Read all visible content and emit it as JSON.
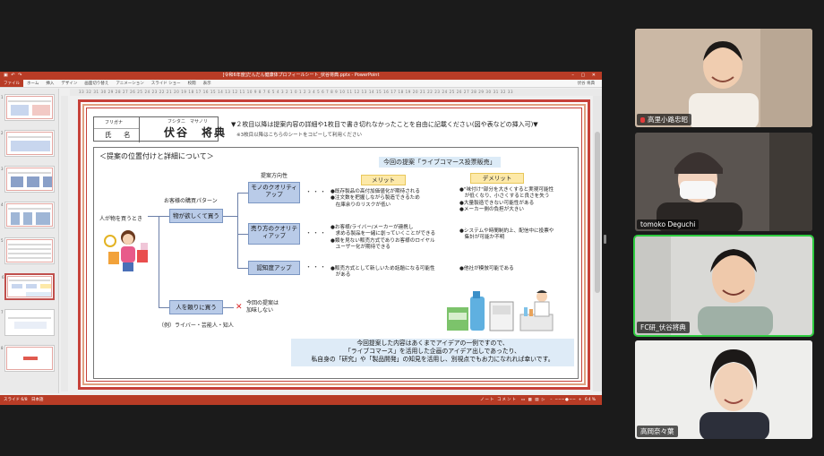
{
  "powerpoint": {
    "title": "[令和6年度]だんだん健康体プロフィールシート_伏谷将典.pptx - PowerPoint",
    "user": "伏谷 将典",
    "file_tab": "ファイル",
    "tabs": [
      "ホーム",
      "挿入",
      "デザイン",
      "画面切り替え",
      "アニメーション",
      "スライド ショー",
      "校閲",
      "表示"
    ],
    "ruler": "33 32 31 30 29 28 27 26 25 24 23 22 21 20 19 18 17 16 15 14 13 12 11 10 9 8 7 6 5 4 3 2 1 0 1 2 3 4 5 6 7 8 9 10 11 12 13 14 15 16 17 18 19 20 21 22 23 24 25 26 27 28 29 30 31 32 33",
    "status_left": "スライド 6/8",
    "status_lang": "日本語",
    "status_right": "ノート  コメント",
    "zoom": "64%",
    "thumbnails": [
      "1",
      "2",
      "3",
      "4",
      "5",
      "6",
      "7",
      "8"
    ]
  },
  "slide": {
    "furigana_label": "フリガナ",
    "name_label": "氏　名",
    "name_reading": "フシタニ　マサノリ",
    "name_value": "伏谷　将典",
    "instruction": "▼２枚目以降は提案内容の詳細や1枚目で書き切れなかったことを自由に記載ください(図や表などの挿入可)▼",
    "instruction_sub": "※3枚目以降はこちらのシートをコピーして利用ください",
    "section_title": "＜提案の位置付けと詳細について＞",
    "proposal_title": "今回の提案「ライブコマース投票販売」",
    "customer_label": "人が物を買うとき",
    "pattern_label": "お客様の購買パターン",
    "direction_label": "提案方向性",
    "box_want": "物が欲しくて買う",
    "box_relation": "人を頼りに買う",
    "box_quality": "モノのクオリティアップ",
    "box_seller": "売り方のクオリティアップ",
    "box_awareness": "認知度アップ",
    "merit": "メリット",
    "demerit": "デメリット",
    "merits_1": [
      "●既存製品の高付加価値化が期待される",
      "●注文数を把握しながら製造できるため",
      "　在庫余りのリスクが低い"
    ],
    "merits_2": [
      "●お客様/ライバー/メーカーが連携し",
      "　求める製品を一緒に創っていくことができる",
      "●類を見ない販売方式でありお客様のロイヤル",
      "　ユーザー化が期待できる"
    ],
    "merits_3": [
      "●販売方式として新しいため話題になる可能性",
      "　がある"
    ],
    "demerits_1": [
      "●\"味付け\"部分を大きくすると実現可能性",
      "　が低くなり、小さくすると良さを失う",
      "●大量製造できない可能性がある",
      "●メーカー側の負担が大きい"
    ],
    "demerits_2": [
      "●システムや時間制約上、配信中に投票や",
      "　集計が可能か不明"
    ],
    "demerits_3": [
      "●他社が模倣可能である"
    ],
    "dots": "・・・",
    "excluded_mark": "✕",
    "excluded_note": "今回の提案は\n加味しない",
    "example_label": "（例）ライバー・芸能人・知人",
    "conclusion": [
      "今回提案した内容はあくまでアイデアの一例ですので、",
      "「ライブコマース」を活用した企画のアイデア出しであったり、",
      "私自身の「研究」や「製品開発」の知見を活用し、別視点でもお力になれれば幸いです。"
    ]
  },
  "participants": [
    {
      "name": "高里小路忠昭",
      "muted": true
    },
    {
      "name": "tomoko Deguchi",
      "muted": false
    },
    {
      "name": "FC研_伏谷将典",
      "muted": false,
      "active": true
    },
    {
      "name": "高岡奈々葉",
      "muted": false
    }
  ],
  "colors": {
    "ppt_accent": "#b83c26",
    "slide_border": "#c7413a",
    "box_blue": "#b9cbe8",
    "merit_yellow": "#fde9a8",
    "conclusion_bg": "#deebf7",
    "active_speaker": "#2ecc40"
  }
}
